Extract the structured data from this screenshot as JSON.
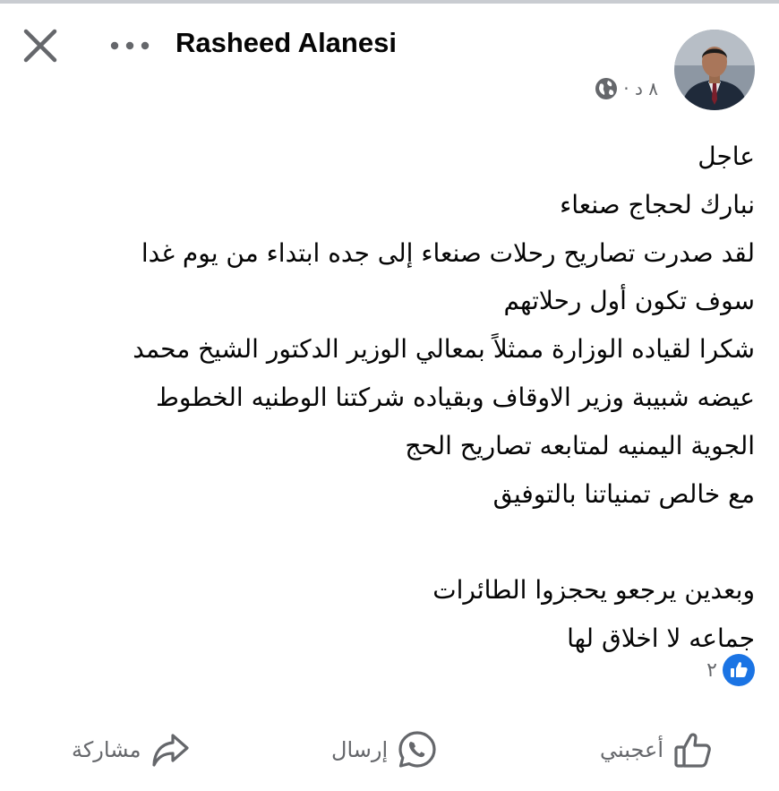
{
  "header": {
    "author_name": "Rasheed Alanesi",
    "timestamp": "٨ د ·",
    "privacy_icon": "globe-icon",
    "close_icon": "close-icon",
    "more_icon": "more-horizontal-icon"
  },
  "post": {
    "lines": [
      "عاجل",
      "نبارك لحجاج صنعاء",
      "لقد صدرت تصاريح رحلات صنعاء إلى جده ابتداء من يوم غدا",
      "سوف تكون أول رحلاتهم",
      "شكرا لقياده الوزارة ممثلاً بمعالي الوزير الدكتور الشيخ محمد",
      "عيضه شبيبة وزير الاوقاف وبقياده شركتنا الوطنيه الخطوط",
      "الجوية اليمنيه لمتابعه تصاريح الحج",
      "مع خالص تمنياتنا بالتوفيق",
      "",
      "وبعدين يرجعو يحجزوا الطائرات",
      "جماعه لا اخلاق لها"
    ]
  },
  "reactions": {
    "count": "٢",
    "icon": "like-reaction-icon"
  },
  "actions": {
    "like_label": "أعجبني",
    "send_label": "إرسال",
    "share_label": "مشاركة"
  },
  "colors": {
    "accent": "#1b74e4",
    "secondary_text": "#65676b",
    "primary_text": "#050505"
  }
}
